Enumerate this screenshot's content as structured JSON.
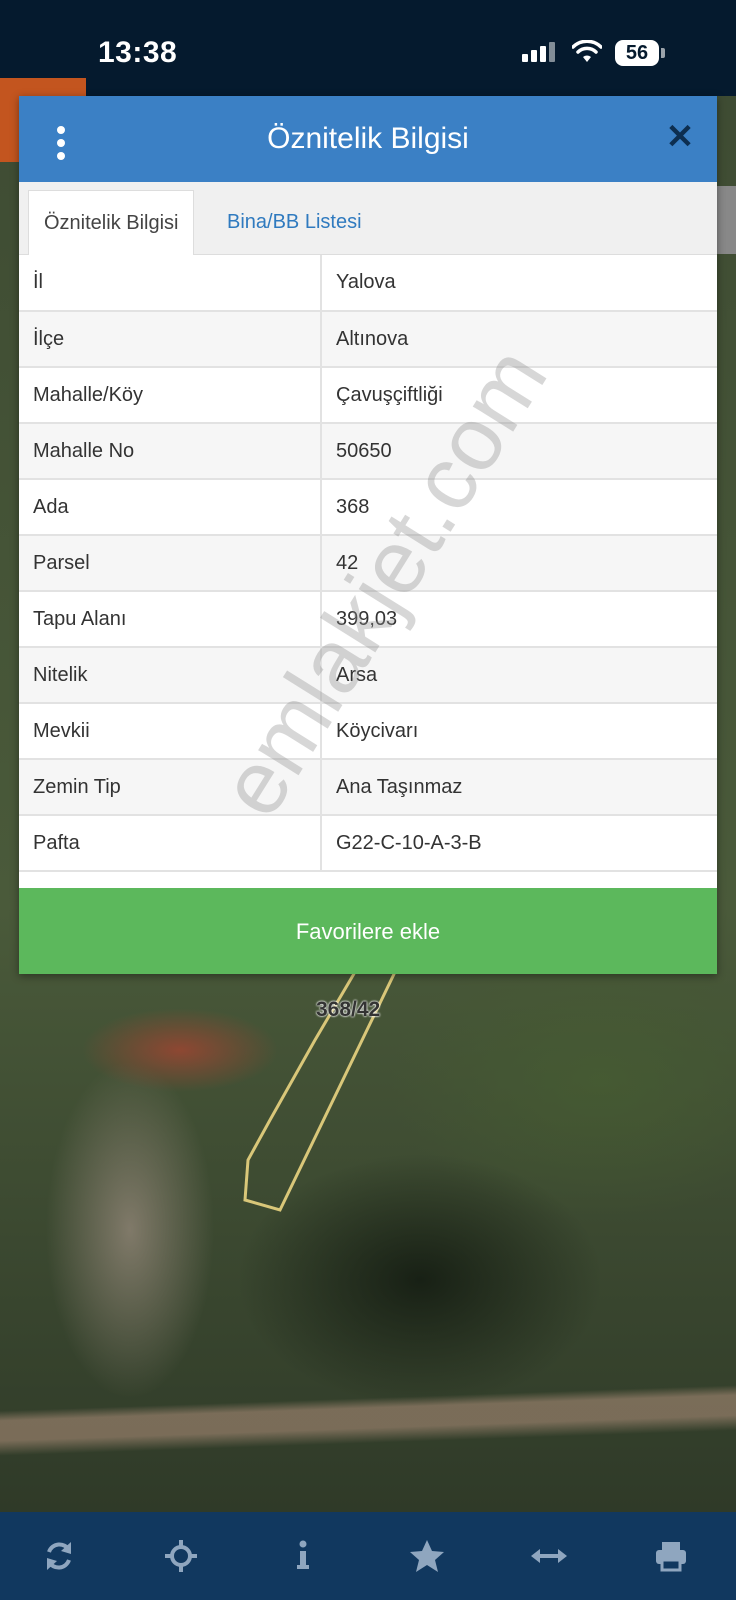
{
  "status_bar": {
    "time": "13:38",
    "battery": "56"
  },
  "dialog": {
    "title": "Öznitelik Bilgisi",
    "tabs": [
      {
        "label": "Öznitelik Bilgisi",
        "active": true
      },
      {
        "label": "Bina/BB Listesi",
        "active": false
      }
    ],
    "rows": [
      {
        "key": "İl",
        "value": "Yalova"
      },
      {
        "key": "İlçe",
        "value": "Altınova"
      },
      {
        "key": "Mahalle/Köy",
        "value": "Çavuşçiftliği"
      },
      {
        "key": "Mahalle No",
        "value": "50650"
      },
      {
        "key": "Ada",
        "value": "368"
      },
      {
        "key": "Parsel",
        "value": "42"
      },
      {
        "key": "Tapu Alanı",
        "value": "399,03"
      },
      {
        "key": "Nitelik",
        "value": "Arsa"
      },
      {
        "key": "Mevkii",
        "value": "Köycivarı"
      },
      {
        "key": "Zemin Tip",
        "value": "Ana Taşınmaz"
      },
      {
        "key": "Pafta",
        "value": "G22-C-10-A-3-B"
      }
    ],
    "favorite_button": "Favorilere ekle"
  },
  "map": {
    "parcel_label": "368/42",
    "watermark": "emlakjet.com"
  },
  "toolbar": {
    "icons": [
      "refresh-icon",
      "locate-icon",
      "info-icon",
      "star-icon",
      "measure-icon",
      "print-icon"
    ]
  },
  "colors": {
    "header": "#3b80c5",
    "favorite": "#5cb85c",
    "toolbar": "#11385f",
    "status_bar": "#051a2e"
  }
}
